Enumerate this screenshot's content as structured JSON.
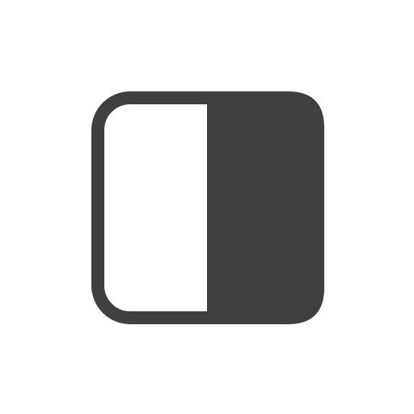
{
  "icon": {
    "name": "half-filled-square-icon",
    "colors": {
      "stroke": "#404040",
      "fill_right": "#404040",
      "fill_left": "#ffffff",
      "background": "#ffffff"
    }
  }
}
